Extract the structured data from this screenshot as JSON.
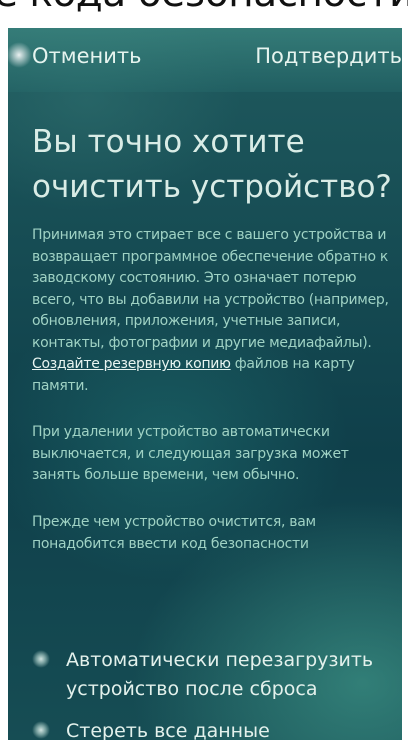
{
  "top_text": "е кода безопасности.",
  "header": {
    "cancel_label": "Отменить",
    "confirm_label": "Подтвердить"
  },
  "title": "Вы точно хотите очистить устройство?",
  "paragraph1": {
    "before_link": "Принимая это стирает все с вашего устройства и возвращает программное обеспечение обратно к заводскому состоянию. Это означает потерю всего, что вы добавили на устройство (например, обновления, приложения, учетные записи, контакты, фотографии и другие медиафайлы). ",
    "link": "Создайте резервную копию",
    "after_link": " файлов на карту памяти."
  },
  "paragraph2": "При удалении устройство автоматически выключается, и следующая загрузка может занять больше времени, чем обычно.",
  "paragraph3": "Прежде чем устройство очистится, вам понадобится ввести код безопасности",
  "options": [
    {
      "label": "Автоматически перезагрузить устройство после сброса"
    },
    {
      "label": "Стереть все данные"
    }
  ]
}
